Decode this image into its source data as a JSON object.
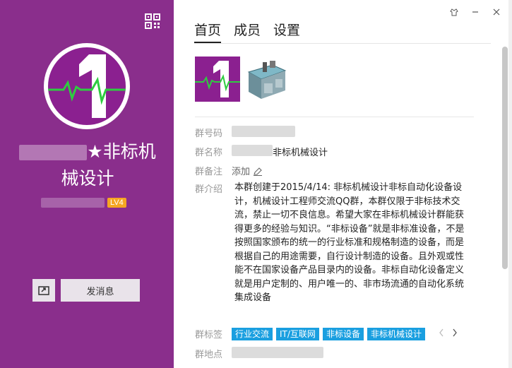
{
  "left": {
    "title_line1": "★非标机",
    "title_line2": "械设计",
    "level": "LV4",
    "send_message": "发消息"
  },
  "tabs": [
    "首页",
    "成员",
    "设置"
  ],
  "fields": {
    "group_number_label": "群号码",
    "group_name_label": "群名称",
    "group_name_value": "非标机械设计",
    "remark_label": "群备注",
    "remark_value": "添加",
    "intro_label": "群介绍",
    "intro_value": "本群创建于2015/4/14: 非标机械设计非标自动化设备设计，机械设计工程师交流QQ群，本群仅限于非标技术交流，禁止一切不良信息。希望大家在非标机械设计群能获得更多的经验与知识。“非标设备”就是非标准设备，不是按照国家颁布的统一的行业标准和规格制造的设备，而是根据自己的用途需要，自行设计制造的设备。且外观或性能不在国家设备产品目录内的设备。非标自动化设备定义就是用户定制的、用户唯一的、非市场流通的自动化系统集成设备",
    "tags_label": "群标签",
    "tags": [
      "行业交流",
      "IT/互联网",
      "非标设备",
      "非标机械设计"
    ],
    "location_label": "群地点"
  },
  "colors": {
    "sidebar": "#8a2e8c",
    "tag": "#1a9fe0",
    "level_badge": "#f5a623",
    "heartbeat": "#2ecc40"
  },
  "icons": {
    "qr": "qr-code-icon",
    "skin": "skin-icon",
    "minimize": "minimize-icon",
    "close": "close-icon",
    "share": "share-icon",
    "edit": "pencil-icon",
    "prev": "chevron-left-icon",
    "next": "chevron-right-icon"
  }
}
